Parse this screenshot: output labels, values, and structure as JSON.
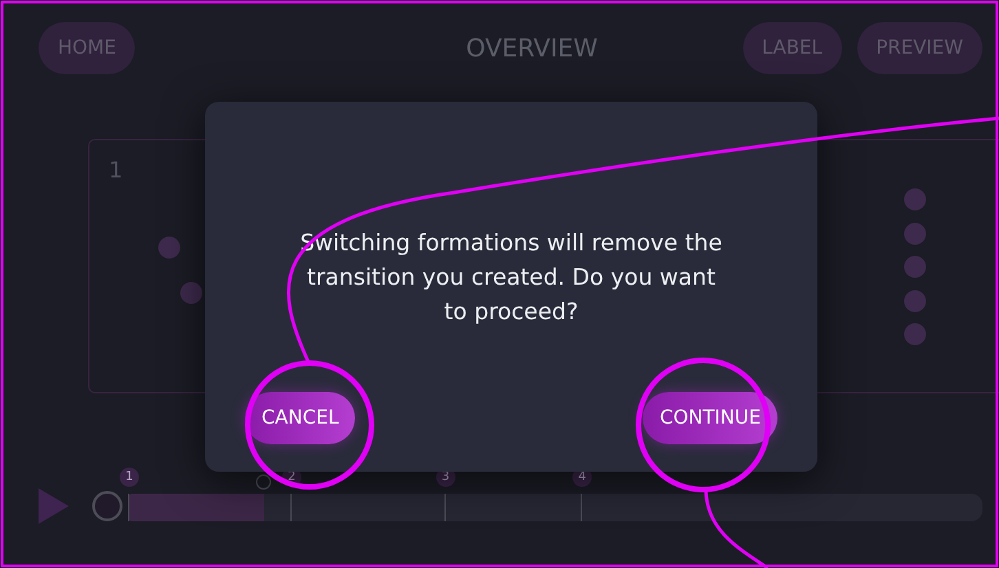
{
  "top_bar": {
    "home": "HOME",
    "title": "OVERVIEW",
    "buttons": [
      "LABEL",
      "PREVIEW"
    ]
  },
  "formations": [
    {
      "number": "1"
    }
  ],
  "dialog": {
    "message": "Switching formations will remove the transition you created. Do you want to proceed?",
    "buttons": [
      "CANCEL",
      "CONTINUE"
    ]
  },
  "timeline": {
    "level": 0.16,
    "markers": [
      "1",
      "2",
      "3",
      "4"
    ]
  }
}
